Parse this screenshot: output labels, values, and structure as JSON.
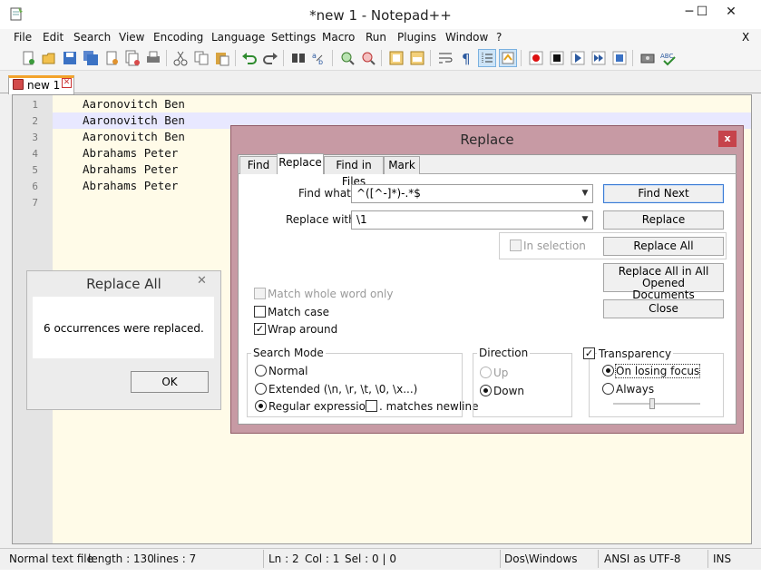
{
  "window": {
    "title": "*new  1 - Notepad++",
    "min": "─",
    "max": "☐",
    "close": "✕"
  },
  "menu": [
    "File",
    "Edit",
    "Search",
    "View",
    "Encoding",
    "Language",
    "Settings",
    "Macro",
    "Run",
    "Plugins",
    "Window",
    "?"
  ],
  "menu_close": "X",
  "tab": {
    "label": "new  1",
    "close": "✕"
  },
  "editor": {
    "line_numbers": [
      "1",
      "2",
      "3",
      "4",
      "5",
      "6",
      "7"
    ],
    "lines": [
      "Aaronovitch Ben",
      "Aaronovitch Ben",
      "Aaronovitch Ben",
      "Abrahams Peter",
      "Abrahams Peter",
      "Abrahams Peter",
      ""
    ],
    "current_line": 2
  },
  "status": {
    "file_type": "Normal text file",
    "length": "length : 130",
    "lines": "lines : 7",
    "ln": "Ln : 2",
    "col": "Col : 1",
    "sel": "Sel : 0 | 0",
    "eol": "Dos\\Windows",
    "encoding": "ANSI as UTF-8",
    "mode": "INS"
  },
  "replace_all_popup": {
    "title": "Replace All",
    "close": "✕",
    "message": "6 occurrences were replaced.",
    "ok": "OK"
  },
  "replace_dialog": {
    "title": "Replace",
    "close": "x",
    "tabs": [
      "Find",
      "Replace",
      "Find in Files",
      "Mark"
    ],
    "active_tab": "Replace",
    "find_what_label": "Find what :",
    "find_what_value": "^([^-]*)-.*$",
    "replace_with_label": "Replace with :",
    "replace_with_value": "\\1",
    "in_selection": "In selection",
    "buttons": {
      "find_next": "Find Next",
      "replace": "Replace",
      "replace_all": "Replace All",
      "replace_all_opened_1": "Replace All in All Opened",
      "replace_all_opened_2": "Documents",
      "close": "Close"
    },
    "options": {
      "match_whole_word": "Match whole word only",
      "match_case": "Match case",
      "wrap_around": "Wrap around",
      "wrap_around_checked": true
    },
    "search_mode": {
      "title": "Search Mode",
      "normal": "Normal",
      "extended": "Extended (\\n, \\r, \\t, \\0, \\x...)",
      "regex": "Regular expression",
      "dot_newline": ". matches newline",
      "selected": "regex"
    },
    "direction": {
      "title": "Direction",
      "up": "Up",
      "down": "Down",
      "selected": "Down"
    },
    "transparency": {
      "title": "Transparency",
      "checked": true,
      "on_losing_focus": "On losing focus",
      "always": "Always",
      "selected": "On losing focus",
      "slider_level": 0.45
    }
  },
  "colors": {
    "editor_bg": "#fffbe8",
    "current_line": "#e8e8ff",
    "dialog_frame": "#c79aa4",
    "dialog_close": "#c6434b"
  }
}
